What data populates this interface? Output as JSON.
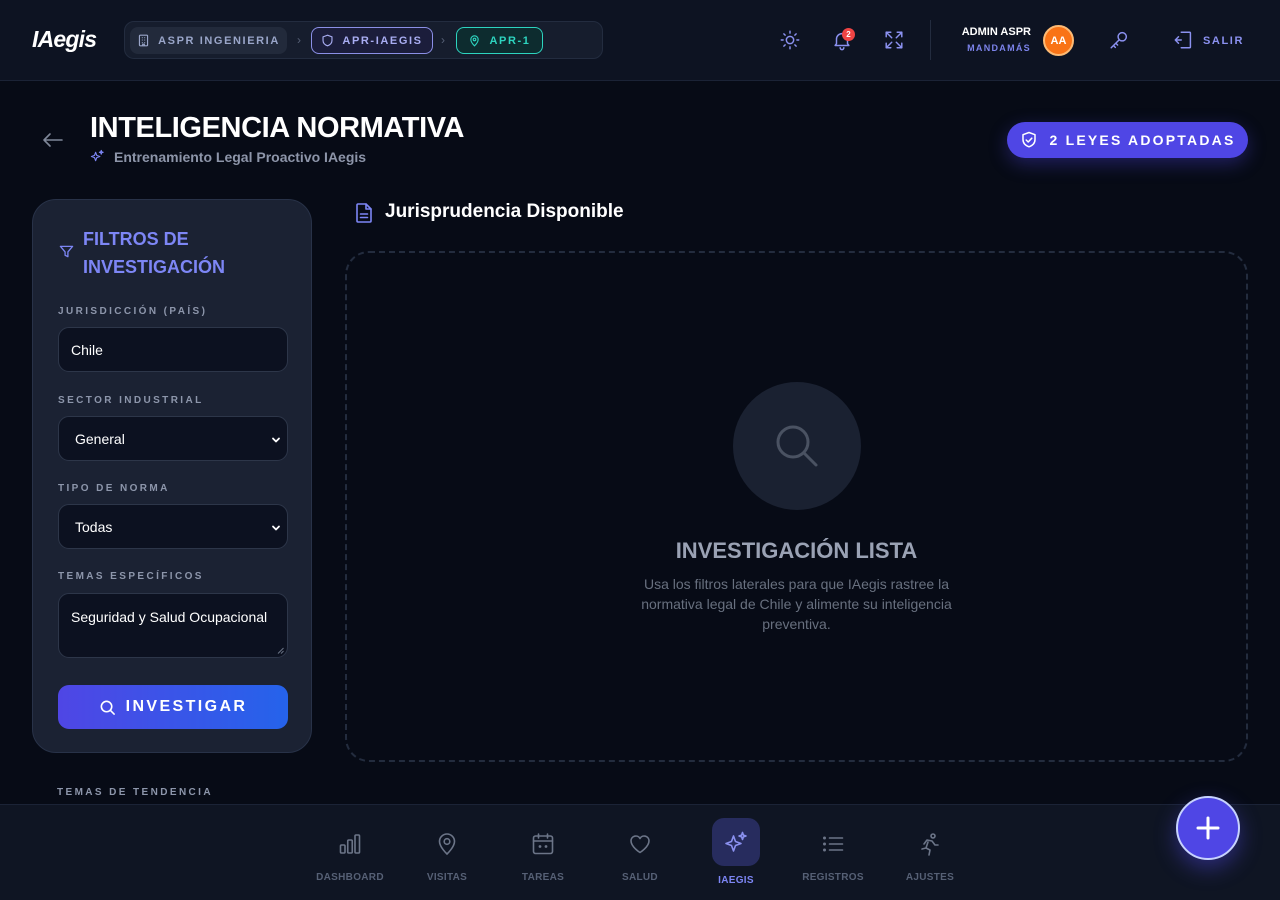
{
  "app": {
    "logo": "IAegis"
  },
  "breadcrumbs": [
    {
      "label": "ASPR INGENIERIA",
      "icon": "building-icon"
    },
    {
      "label": "APR-IAEGIS",
      "icon": "shield-icon"
    },
    {
      "label": "APR-1",
      "icon": "map-pin-icon"
    }
  ],
  "header_actions": {
    "theme_icon": "sun-icon",
    "notifications_icon": "bell-icon",
    "notifications_count": "2",
    "fullscreen_icon": "expand-icon",
    "key_icon": "key-icon",
    "logout_icon": "logout-icon",
    "logout_label": "SALIR"
  },
  "user": {
    "name": "ADMIN ASPR",
    "role": "MANDAMÁS",
    "initials": "AA"
  },
  "page": {
    "title": "INTELIGENCIA NORMATIVA",
    "subtitle": "Entrenamiento Legal Proactivo IAegis",
    "laws_badge": "2 LEYES ADOPTADAS"
  },
  "filters": {
    "title": "FILTROS DE INVESTIGACIÓN",
    "jurisdiction_label": "JURISDICCIÓN (PAÍS)",
    "jurisdiction_value": "Chile",
    "sector_label": "SECTOR INDUSTRIAL",
    "sector_value": "General",
    "norm_type_label": "TIPO DE NORMA",
    "norm_type_value": "Todas",
    "topics_label": "TEMAS ESPECÍFICOS",
    "topics_value": "Seguridad y Salud Ocupacional",
    "submit_label": "INVESTIGAR"
  },
  "trending_label": "TEMAS DE TENDENCIA",
  "main": {
    "section_title": "Jurisprudencia Disponible",
    "empty_title": "INVESTIGACIÓN LISTA",
    "empty_description": "Usa los filtros laterales para que IAegis rastree la normativa legal de Chile y alimente su inteligencia preventiva."
  },
  "bottom_nav": [
    {
      "label": "DASHBOARD",
      "icon": "bar-chart-icon",
      "active": false
    },
    {
      "label": "VISITAS",
      "icon": "map-pin-icon",
      "active": false
    },
    {
      "label": "TAREAS",
      "icon": "calendar-icon",
      "active": false
    },
    {
      "label": "SALUD",
      "icon": "heart-icon",
      "active": false
    },
    {
      "label": "IAEGIS",
      "icon": "sparkles-icon",
      "active": true
    },
    {
      "label": "REGISTROS",
      "icon": "list-icon",
      "active": false
    },
    {
      "label": "AJUSTES",
      "icon": "runner-icon",
      "active": false
    }
  ],
  "colors": {
    "accent": "#4f46e5",
    "accent_light": "#7d86f5",
    "teal": "#2dd4bf",
    "avatar": "#f97316",
    "badge_red": "#ef4444"
  }
}
